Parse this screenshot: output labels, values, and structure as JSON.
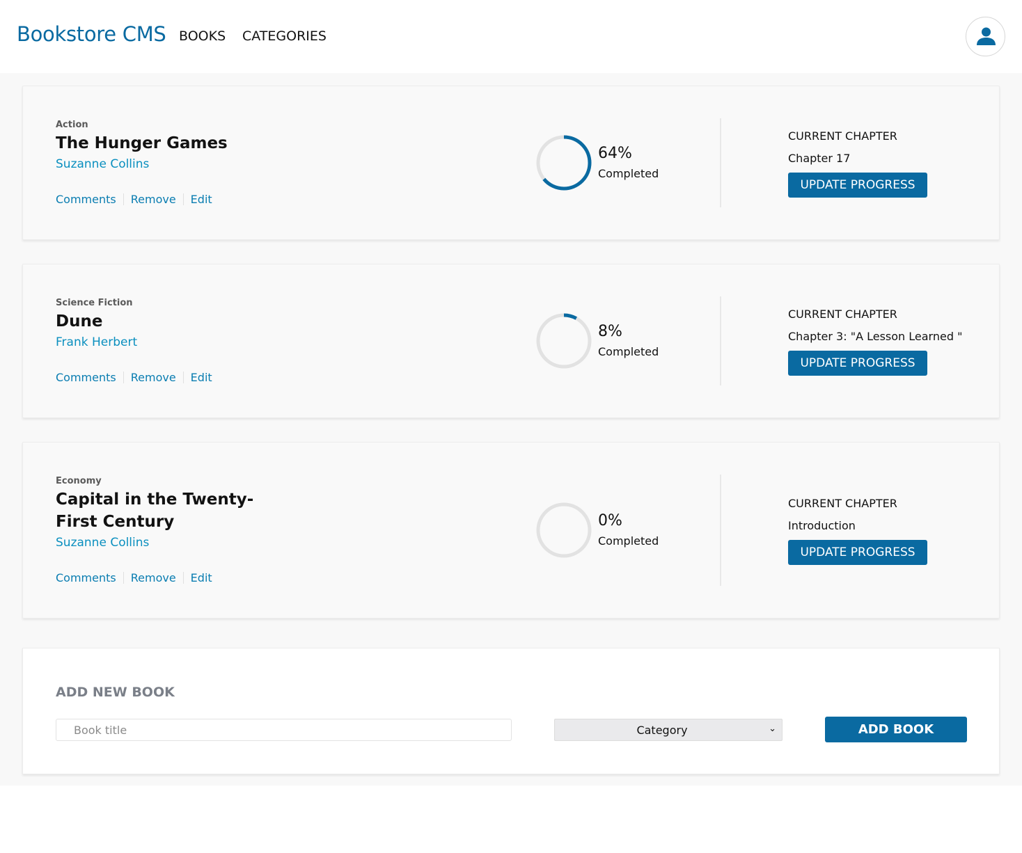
{
  "header": {
    "logo": "Bookstore CMS",
    "nav": [
      "BOOKS",
      "CATEGORIES"
    ],
    "user_icon": "user-icon"
  },
  "books": [
    {
      "genre": "Action",
      "title": "The Hunger Games",
      "author": "Suzanne Collins",
      "actions": [
        "Comments",
        "Remove",
        "Edit"
      ],
      "progress": 64,
      "progress_text": "64%",
      "completed_label": "Completed",
      "current_chapter_label": "CURRENT CHAPTER",
      "current_chapter": "Chapter 17",
      "update_button": "UPDATE PROGRESS"
    },
    {
      "genre": "Science Fiction",
      "title": "Dune",
      "author": "Frank Herbert",
      "actions": [
        "Comments",
        "Remove",
        "Edit"
      ],
      "progress": 8,
      "progress_text": "8%",
      "completed_label": "Completed",
      "current_chapter_label": "CURRENT CHAPTER",
      "current_chapter": "Chapter 3: \"A Lesson Learned \"",
      "update_button": "UPDATE PROGRESS"
    },
    {
      "genre": "Economy",
      "title": "Capital in the Twenty-First Century",
      "author": "Suzanne Collins",
      "actions": [
        "Comments",
        "Remove",
        "Edit"
      ],
      "progress": 0,
      "progress_text": "0%",
      "completed_label": "Completed",
      "current_chapter_label": "CURRENT CHAPTER",
      "current_chapter": "Introduction",
      "update_button": "UPDATE PROGRESS"
    }
  ],
  "add_form": {
    "heading": "ADD NEW BOOK",
    "title_placeholder": "Book title",
    "category_selected": "Category",
    "submit_label": "ADD BOOK"
  },
  "colors": {
    "accent": "#0a6aa1",
    "ring_track": "#e2e2e2",
    "ring_fill": "#0a6aa1"
  }
}
